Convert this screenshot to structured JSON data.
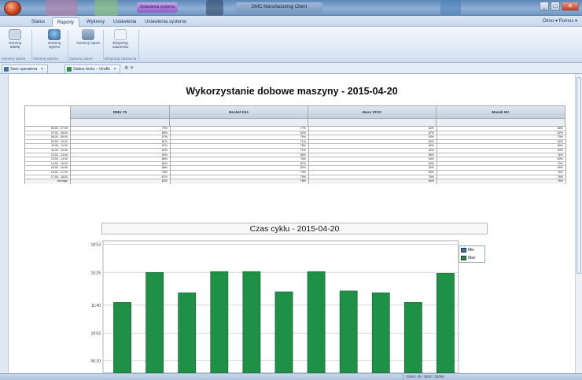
{
  "titlebar": {
    "quick_access_label": "Ustawienia systemu",
    "window_title": "DMC Manufacturing Client",
    "controls": {
      "minimize": "_",
      "maximize": "□",
      "close": "✕"
    }
  },
  "menu": {
    "tabs": [
      "Status",
      "Raporty",
      "Wykresy",
      "Ustawienia",
      "Ustawienia systemu"
    ],
    "active_tab": "Raporty",
    "right_text": "Okno ▾  Pomoc ▾"
  },
  "ribbon": {
    "buttons": [
      {
        "label": "Generuj tabelę",
        "icon": "table-icon",
        "color": "#cfd9e6"
      },
      {
        "label": "Generuj wykres",
        "icon": "chart-icon",
        "color": "#5f86b3"
      },
      {
        "label": "Generuj raport",
        "icon": "report-icon",
        "color": "#8aa4c4"
      },
      {
        "label": "Eksportuj zdarzenia",
        "icon": "cursor-icon",
        "color": "#e8eef6"
      }
    ],
    "groups": [
      "Generuj tabelę",
      "Generuj wykres",
      "Generuj raport",
      "Eksportuj zdarzenia"
    ]
  },
  "doc_tabs": [
    {
      "label": "Stan operatora",
      "icon": "operator-icon"
    },
    {
      "label": "Status testu – Grafik",
      "icon": "status-icon"
    }
  ],
  "report": {
    "title": "Wykorzystanie dobowe maszyny - 2015-04-20",
    "columns": [
      "DMU 70",
      "Deckel D11",
      "Hass VF2C",
      "Mazak M+"
    ],
    "rows": [
      {
        "time": "06:00 - 07:00",
        "v": [
          "79%",
          "77%",
          "83%",
          "68%"
        ]
      },
      {
        "time": "07:00 - 08:00",
        "v": [
          "80%",
          "82%",
          "87%",
          "62%"
        ]
      },
      {
        "time": "08:00 - 09:00",
        "v": [
          "87%",
          "76%",
          "83%",
          "79%"
        ]
      },
      {
        "time": "09:00 - 10:00",
        "v": [
          "81%",
          "71%",
          "80%",
          "82%"
        ]
      },
      {
        "time": "10:00 - 11:00",
        "v": [
          "87%",
          "78%",
          "80%",
          "80%"
        ]
      },
      {
        "time": "11:00 - 12:00",
        "v": [
          "84%",
          "71%",
          "82%",
          "84%"
        ]
      },
      {
        "time": "12:00 - 13:00",
        "v": [
          "82%",
          "86%",
          "86%",
          "76%"
        ]
      },
      {
        "time": "13:00 - 14:00",
        "v": [
          "88%",
          "76%",
          "84%",
          "83%"
        ]
      },
      {
        "time": "14:00 - 15:00",
        "v": [
          "82%",
          "87%",
          "82%",
          "72%"
        ]
      },
      {
        "time": "15:00 - 16:00",
        "v": [
          "88%",
          "82%",
          "83%",
          "89%"
        ]
      },
      {
        "time": "16:00 - 17:00",
        "v": [
          "78%",
          "79%",
          "80%",
          "76%"
        ]
      },
      {
        "time": "17:00 - 18:00",
        "v": [
          "87%",
          "75%",
          "76%",
          "78%"
        ]
      }
    ],
    "average": {
      "label": "Average",
      "v": [
        "82%",
        "78%",
        "84%",
        "78%"
      ]
    }
  },
  "chart_data": {
    "type": "bar",
    "title": "Czas cyklu - 2015-04-20",
    "y_tick_labels": [
      "18:53",
      "15:25",
      "11:40",
      "10:03",
      "06:20"
    ],
    "series": [
      {
        "name": "Min",
        "color": "#3a73b5",
        "values": []
      },
      {
        "name": "Max",
        "color": "#1e9147",
        "values": [
          12.0,
          15.4,
          13.1,
          15.5,
          15.5,
          13.2,
          15.5,
          13.3,
          13.1,
          12.0,
          15.3
        ]
      }
    ],
    "ylim": [
      4,
      19
    ],
    "grid": true,
    "legend_position": "top-right"
  },
  "status": {
    "text": "Dzień: 4h / 25/sz / 20/3sz"
  }
}
